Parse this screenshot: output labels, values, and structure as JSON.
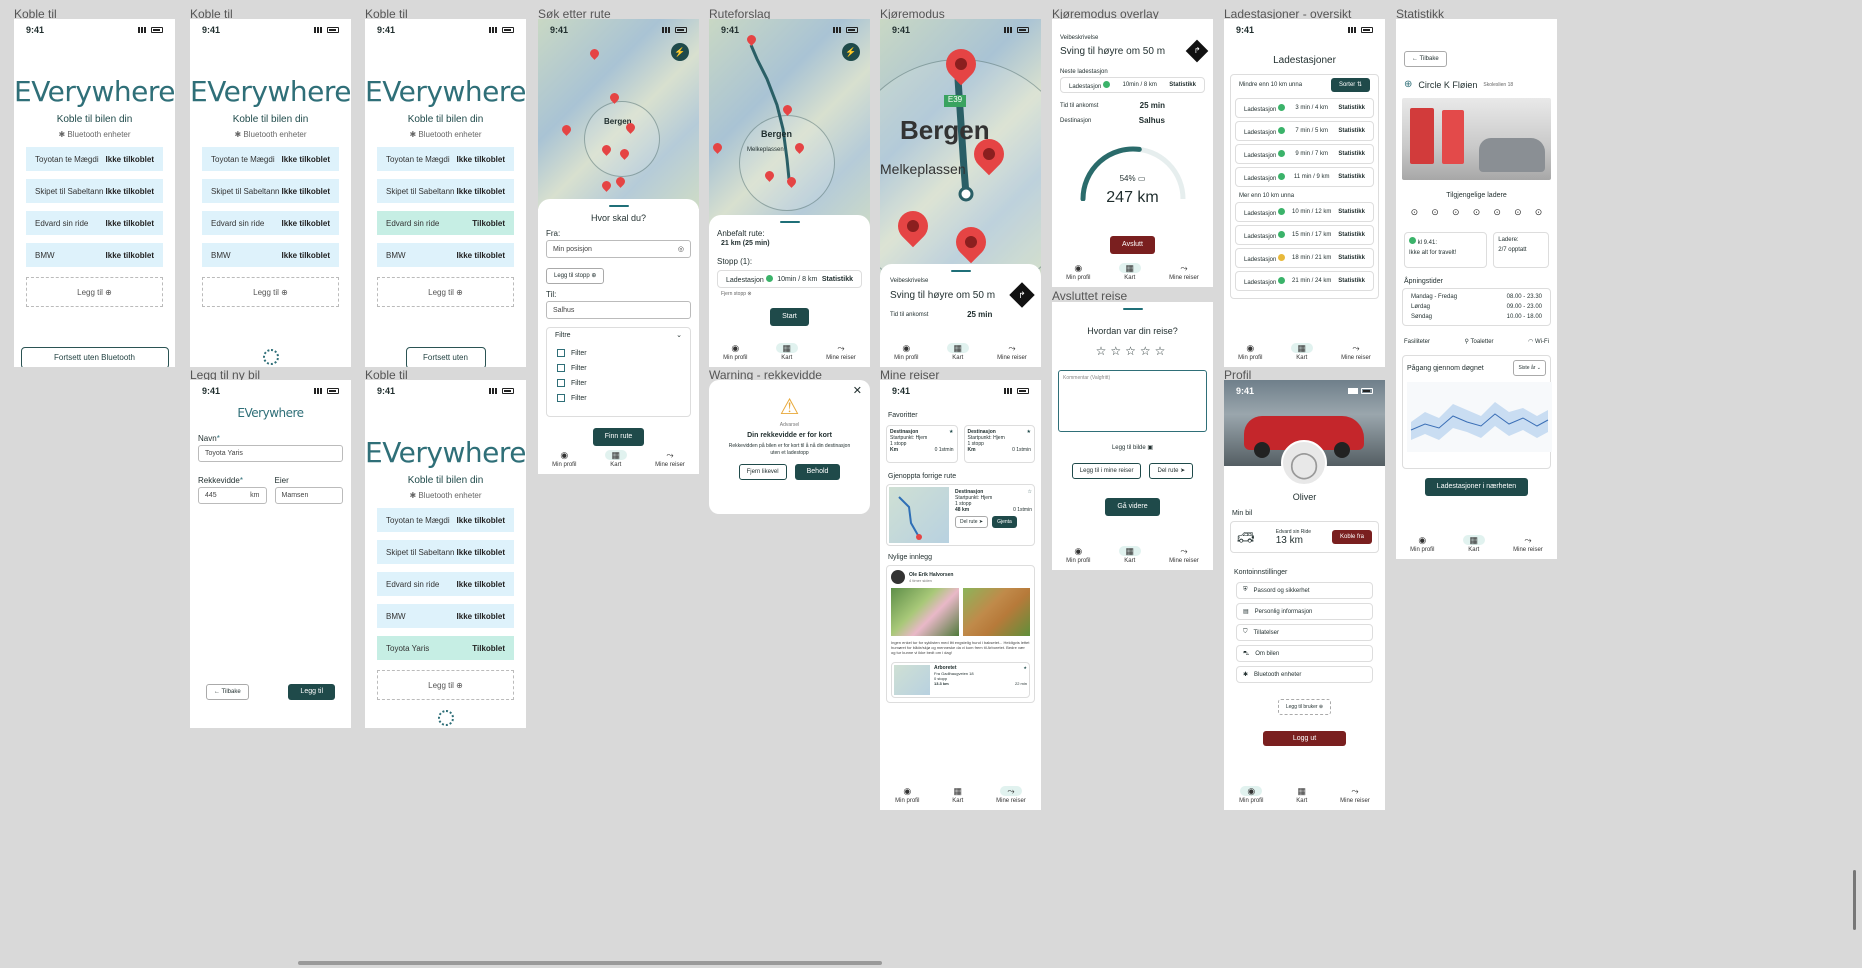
{
  "frames": {
    "f1": "Koble til",
    "f2": "Koble til",
    "f3": "Koble til",
    "f4": "Søk etter rute",
    "f5": "Ruteforslag",
    "f6": "Kjøremodus",
    "f7": "Kjøremodus overlay",
    "f8": "Ladestasjoner - oversikt",
    "f9": "Statistikk",
    "f10": "Legg til ny bil",
    "f11": "Koble til",
    "f12": "Warning - rekkevidde",
    "f13": "Mine reiser",
    "f14": "Avsluttet reise",
    "f15": "Profil"
  },
  "status_time": "9:41",
  "connect": {
    "logo": "EVerywhere",
    "subtitle": "Koble til bilen din",
    "bt": "Bluetooth enheter",
    "devices": [
      {
        "name": "Toyotan te Mægdi",
        "state": "Ikke tilkoblet"
      },
      {
        "name": "Skipet til Sabeltann",
        "state": "Ikke tilkoblet"
      },
      {
        "name": "Edvard sin ride",
        "state": "Ikke tilkoblet"
      },
      {
        "name": "BMW",
        "state": "Ikke tilkoblet"
      }
    ],
    "connected_state": "Tilkoblet",
    "new_car": "Toyota Yaris",
    "add": "Legg til ⊕",
    "continue": "Fortsett uten Bluetooth"
  },
  "search": {
    "title": "Hvor skal du?",
    "from_label": "Fra:",
    "from_value": "Min posisjon",
    "add_stop": "Legg til stopp ⊕",
    "to_label": "Til:",
    "to_value": "Salhus",
    "filters_title": "Filtre",
    "filter": "Filter",
    "find": "Finn rute",
    "map_label": "Bergen"
  },
  "nav": {
    "profile": "Min profil",
    "map": "Kart",
    "trips": "Mine reiser"
  },
  "route": {
    "recommended": "Anbefalt rute:",
    "recommended_value": "21 km (25 min)",
    "stops": "Stopp (1):",
    "station": "Ladestasjon",
    "station_time": "10min / 8 km",
    "stats": "Statistikk",
    "remove": "Fjern stopp ⊗",
    "start": "Start",
    "map_label": "Bergen",
    "map_label2": "Melkeplassen"
  },
  "drive": {
    "city": "Bergen",
    "area": "Melkeplassen",
    "road": "E39",
    "desc_label": "Veibeskrivelse",
    "instruction": "Sving til høyre om 50 m",
    "arrival_label": "Tid til ankomst",
    "arrival": "25 min"
  },
  "overlay": {
    "desc_label": "Veibeskrivelse",
    "instruction": "Sving til høyre om 50 m",
    "next_label": "Neste ladestasjon",
    "station": "Ladestasjon",
    "station_time": "10min / 8 km",
    "stats": "Statistikk",
    "arrival_label": "Tid til ankomst",
    "arrival": "25 min",
    "dest_label": "Destinasjon",
    "dest": "Salhus",
    "battery_pct": "54%",
    "battery_fraction": 0.54,
    "range": "247 km",
    "end": "Avslutt"
  },
  "stations": {
    "title": "Ladestasjoner",
    "near_label": "Mindre enn 10 km unna",
    "sort": "Sorter ⇅",
    "near": [
      {
        "t": "3 min / 4 km"
      },
      {
        "t": "7 min / 5 km"
      },
      {
        "t": "9 min / 7 km"
      },
      {
        "t": "11 min / 9 km"
      }
    ],
    "far_label": "Mer enn 10 km unna",
    "far": [
      {
        "t": "10 min / 12 km",
        "c": "green"
      },
      {
        "t": "15 min / 17 km",
        "c": "green"
      },
      {
        "t": "18 min / 21 km",
        "c": "yellow"
      },
      {
        "t": "21 min / 24 km",
        "c": "green"
      }
    ],
    "name": "Ladestasjon",
    "stats": "Statistikk"
  },
  "stats": {
    "back": "← Tilbake",
    "place": "Circle K Fløien",
    "address": "Skoleslien 18",
    "available": "Tilgjengelige ladere",
    "open_time": "kl 9.41:",
    "open_note": "Ikke alt for travelt!",
    "chargers_label": "Ladere:",
    "chargers_value": "2/7 opptatt",
    "hours_title": "Åpningstider",
    "hours": [
      {
        "d": "Mandag - Fredag",
        "h": "08.00 - 23.30"
      },
      {
        "d": "Lørdag",
        "h": "09.00 - 23.00"
      },
      {
        "d": "Søndag",
        "h": "10.00 - 18.00"
      }
    ],
    "facilities": "Fasiliteter",
    "toilet": "Toaletter",
    "wifi": "Wi-Fi",
    "ongoing": "Pågang gjennom døgnet",
    "period": "Siste år",
    "nearby": "Ladestasjoner i nærheten"
  },
  "newcar": {
    "logo": "EVerywhere",
    "name_label": "Navn",
    "name_value": "Toyota Yaris",
    "range_label": "Rekkevidde",
    "range_value": "445",
    "range_unit": "km",
    "owner_label": "Eier",
    "owner_value": "Mamsen",
    "back": "← Tilbake",
    "add": "Legg til"
  },
  "warning": {
    "title": "Advarsel",
    "heading": "Din rekkevidde er for kort",
    "text": "Rekkevidden på bilen er for kort til å nå din destinasjon uten et ladestopp",
    "remove": "Fjern likevel",
    "keep": "Behold"
  },
  "trips": {
    "favorites": "Favoritter",
    "fav": [
      {
        "title": "Destinasjon",
        "sub": "Startpunkt: Hjem",
        "stops": "1 stopp",
        "km": "Km",
        "time": "0 1stmin"
      },
      {
        "title": "Destinasjon",
        "sub": "Startpunkt: Hjem",
        "stops": "1 stopp",
        "km": "Km",
        "time": "0 1stmin"
      }
    ],
    "resume": "Gjenoppta forrige rute",
    "resume_card": {
      "title": "Destinasjon",
      "sub": "Startpunkt: Hjem",
      "stops": "1 stopp",
      "km": "48 km",
      "time": "0 1stmin",
      "share": "Del rute",
      "resume": "Gjenta"
    },
    "recent": "Nylige innlegg",
    "post_author": "Ole Erik Halvorsen",
    "post_time": "4 timer siden",
    "post_text": "Ingen enkel tur for syklisten med litt engstelig hund i baksetet... Heldigvis lettet humøret for både/skjø og menneske da vi kom frem til Arboretet. Bedre vær og tur kunne vi ikke bedt om i dag!",
    "post2_title": "Arboretet",
    "post2_sub": "Fra Gadlhaugveien 18",
    "post2_stops": "0 stopp",
    "post2_km": "13.3 km",
    "post2_time": "22 min"
  },
  "ended": {
    "question": "Hvordan var din reise?",
    "comment": "Kommentar (Valgfritt)",
    "add_image": "Legg til bilde",
    "add_trips": "Legg til i mine reiser",
    "share": "Del rute",
    "go_on": "Gå videre"
  },
  "profile": {
    "name": "Oliver",
    "car_label": "Min bil",
    "car_name": "Edvard sin Ride",
    "car_range": "13 km",
    "disconnect": "Koble fra",
    "account": "Kontoinnstillinger",
    "items": [
      "Passord og sikkerhet",
      "Personlig informasjon",
      "Tillatelser",
      "Om bilen",
      "Bluetooth enheter"
    ],
    "add_user": "Legg til bruker ⊕",
    "logout": "Logg ut"
  }
}
